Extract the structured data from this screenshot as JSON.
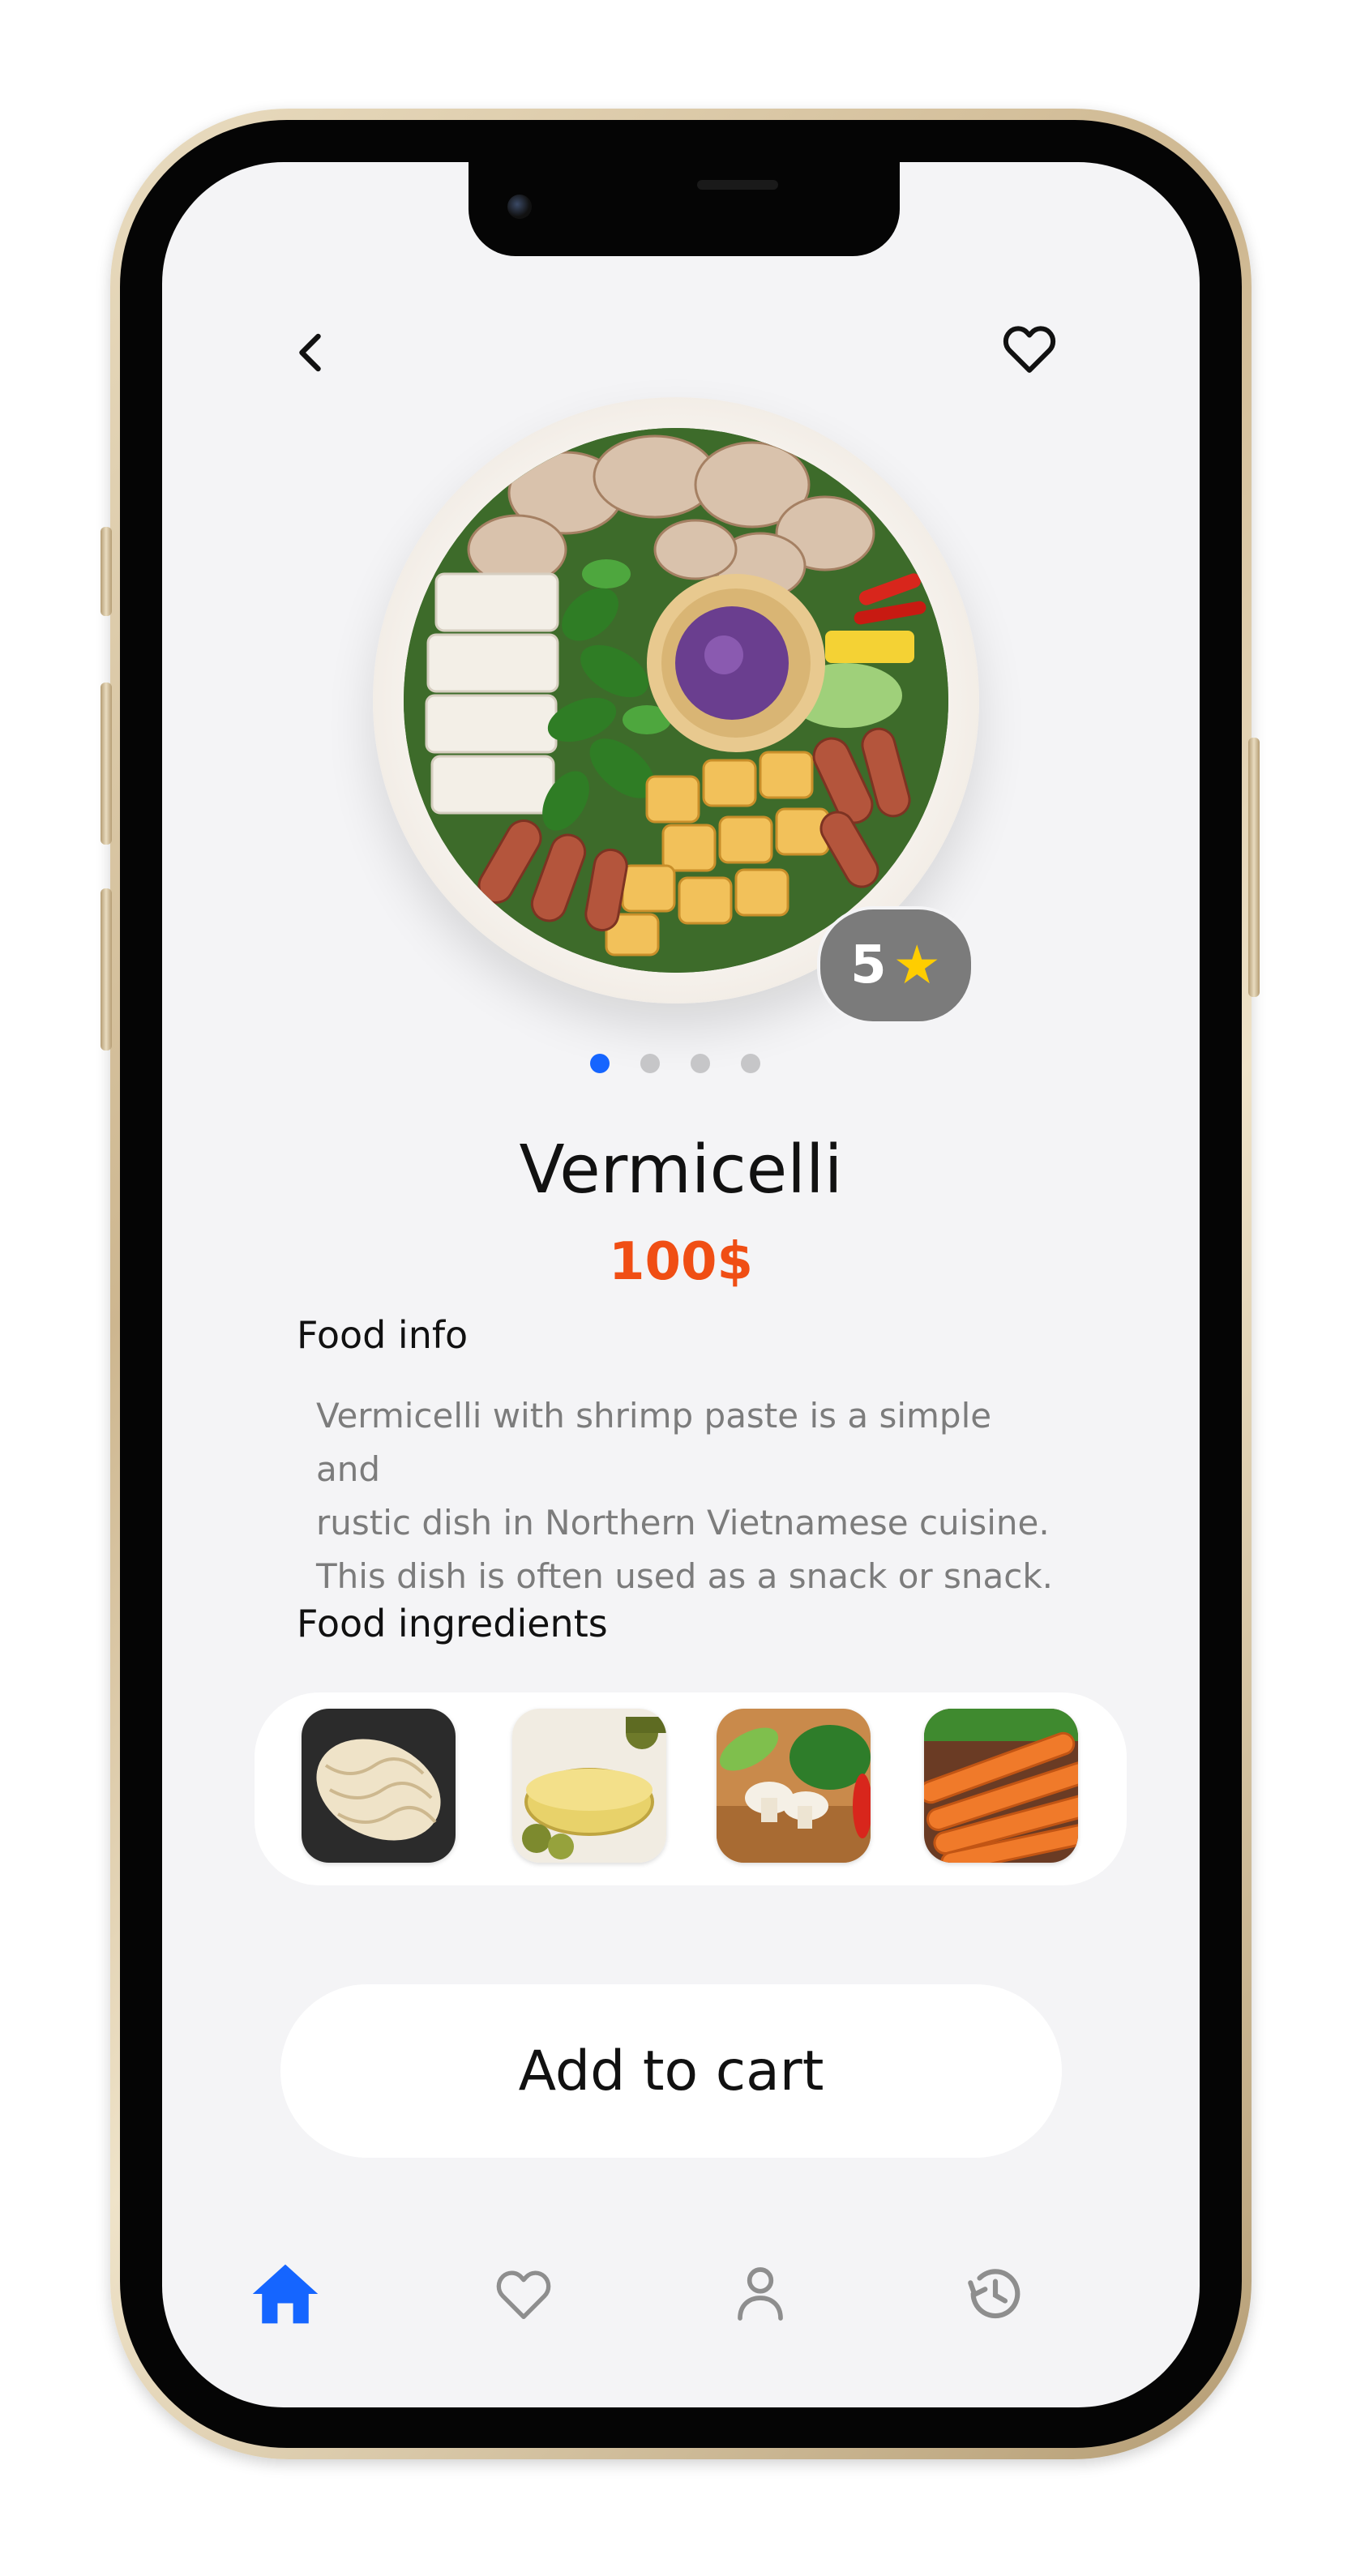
{
  "icons": {
    "back": "chevron-left-icon",
    "favorite": "heart-outline-icon",
    "rating_star": "star-icon",
    "tab_home": "home-icon",
    "tab_favorites": "heart-icon",
    "tab_profile": "person-icon",
    "tab_history": "history-icon"
  },
  "colors": {
    "accent": "#1565ff",
    "price": "#f04e14",
    "star": "#ffcd00",
    "screen_bg": "#f4f4f6"
  },
  "rating": {
    "value": "5",
    "star": "★"
  },
  "carousel": {
    "count": 4,
    "active_index": 0
  },
  "food": {
    "name": "Vermicelli",
    "price": "100$"
  },
  "food_info": {
    "label": "Food info",
    "lines": [
      "Vermicelli with shrimp paste is a simple and",
      "rustic dish in Northern Vietnamese cuisine.",
      "This dish is often used as a snack or snack."
    ]
  },
  "food_ingredients": {
    "label": "Food ingredients",
    "items": [
      "rice-noodles",
      "olive-oil",
      "mushrooms-herbs",
      "carrots"
    ]
  },
  "cart": {
    "label": "Add to cart"
  },
  "tabbar": {
    "active": "home"
  }
}
